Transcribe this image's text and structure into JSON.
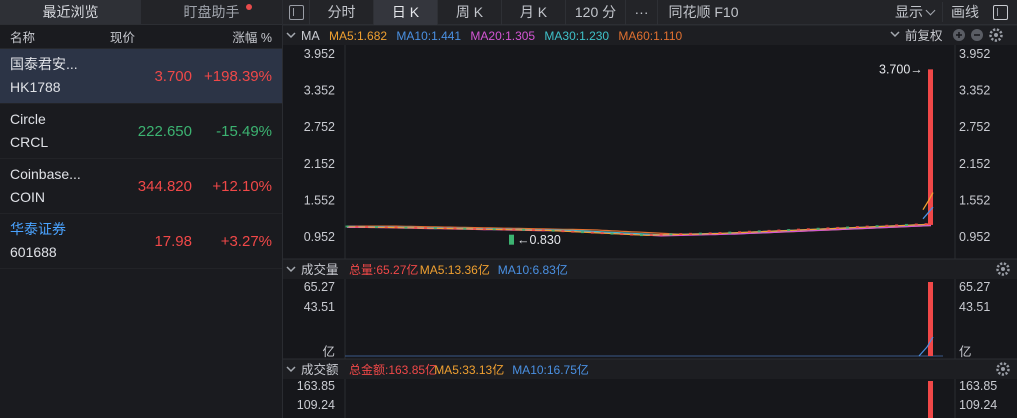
{
  "left": {
    "tabs": [
      "最近浏览",
      "盯盘助手"
    ],
    "headers": {
      "name": "名称",
      "price": "现价",
      "change": "涨幅 %"
    },
    "rows": [
      {
        "name": "国泰君安...",
        "code": "HK1788",
        "price": "3.700",
        "change": "+198.39%",
        "dir": "up",
        "selected": true,
        "blue": false
      },
      {
        "name": "Circle",
        "code": "CRCL",
        "price": "222.650",
        "change": "-15.49%",
        "dir": "dn",
        "selected": false,
        "blue": false
      },
      {
        "name": "Coinbase...",
        "code": "COIN",
        "price": "344.820",
        "change": "+12.10%",
        "dir": "up",
        "selected": false,
        "blue": false
      },
      {
        "name": "华泰证券",
        "code": "601688",
        "price": "17.98",
        "change": "+3.27%",
        "dir": "up",
        "selected": false,
        "blue": true
      }
    ]
  },
  "toolbar": {
    "tabs": [
      "分时",
      "日 K",
      "周 K",
      "月 K",
      "120 分",
      "···",
      "同花顺 F10"
    ],
    "active": 1,
    "display_label": "显示",
    "draw_label": "画线"
  },
  "price_panel": {
    "ma_title": "MA",
    "ma": [
      {
        "label": "MA5:1.682",
        "color": "#f0a030"
      },
      {
        "label": "MA10:1.441",
        "color": "#4a90e2"
      },
      {
        "label": "MA20:1.305",
        "color": "#d455d4"
      },
      {
        "label": "MA30:1.230",
        "color": "#3fc1c9"
      },
      {
        "label": "MA60:1.110",
        "color": "#e07030"
      }
    ],
    "adjust_label": "前复权",
    "y_ticks": [
      "3.952",
      "3.352",
      "2.752",
      "2.152",
      "1.552",
      "0.952"
    ],
    "y_values": [
      3.952,
      3.352,
      2.752,
      2.152,
      1.552,
      0.952
    ],
    "high_label": "3.700",
    "low_label": "0.830"
  },
  "volume_panel": {
    "title": "成交量",
    "items": [
      {
        "label": "总量:65.27亿",
        "color": "#f04848"
      },
      {
        "label": "MA5:13.36亿",
        "color": "#f0a030"
      },
      {
        "label": "MA10:6.83亿",
        "color": "#4a90e2"
      }
    ],
    "y_ticks": [
      "65.27",
      "43.51",
      "亿"
    ]
  },
  "amount_panel": {
    "title": "成交额",
    "items": [
      {
        "label": "总金额:163.85亿",
        "color": "#f04848"
      },
      {
        "label": "MA5:33.13亿",
        "color": "#f0a030"
      },
      {
        "label": "MA10:16.75亿",
        "color": "#4a90e2"
      }
    ],
    "y_ticks": [
      "163.85",
      "109.24"
    ]
  }
}
